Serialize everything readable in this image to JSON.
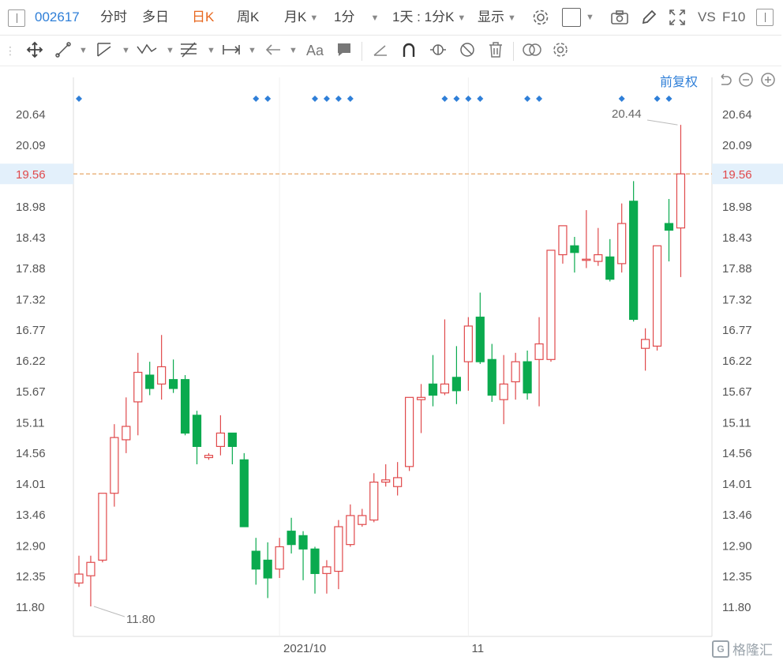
{
  "toolbar": {
    "code": "002617",
    "tabs": [
      "分时",
      "多日",
      "日K",
      "周K",
      "月K"
    ],
    "active_tab": "日K",
    "interval": "1分",
    "range": "1天 : 1分K",
    "display": "显示",
    "vs": "VS",
    "f10": "F10"
  },
  "price_mode": "前复权",
  "colors": {
    "up": "#e0494b",
    "down": "#0aaa4e",
    "accent": "#2f7fd8",
    "active_tab": "#e8681f",
    "price_line": "#e8a867"
  },
  "watermark": "格隆汇",
  "chart_data": {
    "type": "candlestick",
    "y_ticks": [
      "20.64",
      "20.09",
      "19.56",
      "18.98",
      "18.43",
      "17.88",
      "17.32",
      "16.77",
      "16.22",
      "15.67",
      "15.11",
      "14.56",
      "14.01",
      "13.46",
      "12.90",
      "12.35",
      "11.80"
    ],
    "ylim": [
      11.8,
      20.64
    ],
    "x_tick_labels": [
      {
        "label": "2021/10",
        "index": 17
      },
      {
        "label": "11",
        "index": 33
      }
    ],
    "current_price": "19.56",
    "max_label": "20.44",
    "min_label": "11.80",
    "max_index": 51,
    "min_index": 1,
    "event_marker_indices": [
      0,
      15,
      16,
      20,
      21,
      22,
      23,
      31,
      32,
      33,
      34,
      38,
      39,
      46,
      49,
      50
    ],
    "candles": [
      {
        "o": 12.22,
        "c": 12.38,
        "h": 12.71,
        "l": 12.15
      },
      {
        "o": 12.35,
        "c": 12.59,
        "h": 12.71,
        "l": 11.8
      },
      {
        "o": 12.63,
        "c": 13.83,
        "h": 13.83,
        "l": 12.59
      },
      {
        "o": 13.83,
        "c": 14.83,
        "h": 15.07,
        "l": 13.59
      },
      {
        "o": 14.79,
        "c": 15.03,
        "h": 15.55,
        "l": 14.55
      },
      {
        "o": 15.47,
        "c": 16.0,
        "h": 16.35,
        "l": 14.87
      },
      {
        "o": 15.95,
        "c": 15.71,
        "h": 16.19,
        "l": 15.59
      },
      {
        "o": 15.79,
        "c": 16.1,
        "h": 16.67,
        "l": 15.51
      },
      {
        "o": 15.87,
        "c": 15.71,
        "h": 16.23,
        "l": 15.63
      },
      {
        "o": 15.87,
        "c": 14.91,
        "h": 15.95,
        "l": 14.87
      },
      {
        "o": 15.23,
        "c": 14.67,
        "h": 15.31,
        "l": 14.35
      },
      {
        "o": 14.47,
        "c": 14.51,
        "h": 14.55,
        "l": 14.43
      },
      {
        "o": 14.67,
        "c": 14.91,
        "h": 15.23,
        "l": 14.51
      },
      {
        "o": 14.91,
        "c": 14.67,
        "h": 14.91,
        "l": 14.35
      },
      {
        "o": 14.43,
        "c": 13.23,
        "h": 14.55,
        "l": 13.23
      },
      {
        "o": 12.79,
        "c": 12.47,
        "h": 13.03,
        "l": 12.19
      },
      {
        "o": 12.63,
        "c": 12.31,
        "h": 12.95,
        "l": 11.95
      },
      {
        "o": 12.47,
        "c": 12.87,
        "h": 13.03,
        "l": 12.31
      },
      {
        "o": 13.15,
        "c": 12.91,
        "h": 13.39,
        "l": 12.75
      },
      {
        "o": 13.07,
        "c": 12.83,
        "h": 13.15,
        "l": 12.27
      },
      {
        "o": 12.83,
        "c": 12.39,
        "h": 12.87,
        "l": 12.03
      },
      {
        "o": 12.39,
        "c": 12.51,
        "h": 12.63,
        "l": 12.03
      },
      {
        "o": 12.43,
        "c": 13.23,
        "h": 13.35,
        "l": 12.11
      },
      {
        "o": 12.91,
        "c": 13.43,
        "h": 13.63,
        "l": 12.87
      },
      {
        "o": 13.27,
        "c": 13.43,
        "h": 13.55,
        "l": 13.23
      },
      {
        "o": 13.35,
        "c": 14.03,
        "h": 14.19,
        "l": 13.31
      },
      {
        "o": 14.03,
        "c": 14.07,
        "h": 14.35,
        "l": 13.95
      },
      {
        "o": 13.95,
        "c": 14.11,
        "h": 14.39,
        "l": 13.79
      },
      {
        "o": 14.31,
        "c": 15.55,
        "h": 15.55,
        "l": 14.23
      },
      {
        "o": 15.51,
        "c": 15.55,
        "h": 15.79,
        "l": 14.91
      },
      {
        "o": 15.79,
        "c": 15.59,
        "h": 16.31,
        "l": 15.39
      },
      {
        "o": 15.63,
        "c": 15.79,
        "h": 16.95,
        "l": 15.59
      },
      {
        "o": 15.91,
        "c": 15.67,
        "h": 16.47,
        "l": 15.43
      },
      {
        "o": 16.19,
        "c": 16.83,
        "h": 16.99,
        "l": 15.67
      },
      {
        "o": 16.99,
        "c": 16.19,
        "h": 17.43,
        "l": 16.15
      },
      {
        "o": 16.23,
        "c": 15.59,
        "h": 16.51,
        "l": 15.47
      },
      {
        "o": 15.51,
        "c": 15.79,
        "h": 16.31,
        "l": 15.07
      },
      {
        "o": 15.83,
        "c": 16.19,
        "h": 16.35,
        "l": 15.51
      },
      {
        "o": 16.19,
        "c": 15.63,
        "h": 16.39,
        "l": 15.51
      },
      {
        "o": 16.23,
        "c": 16.51,
        "h": 16.99,
        "l": 15.39
      },
      {
        "o": 16.23,
        "c": 18.19,
        "h": 18.19,
        "l": 16.19
      },
      {
        "o": 18.11,
        "c": 18.63,
        "h": 18.63,
        "l": 17.95
      },
      {
        "o": 18.27,
        "c": 18.15,
        "h": 18.43,
        "l": 17.79
      },
      {
        "o": 18.03,
        "c": 18.03,
        "h": 18.91,
        "l": 17.87
      },
      {
        "o": 17.99,
        "c": 18.11,
        "h": 18.59,
        "l": 17.91
      },
      {
        "o": 18.07,
        "c": 17.67,
        "h": 18.39,
        "l": 17.63
      },
      {
        "o": 17.95,
        "c": 18.67,
        "h": 19.03,
        "l": 17.79
      },
      {
        "o": 19.07,
        "c": 16.95,
        "h": 19.43,
        "l": 16.91
      },
      {
        "o": 16.43,
        "c": 16.59,
        "h": 16.79,
        "l": 16.03
      },
      {
        "o": 16.47,
        "c": 18.27,
        "h": 18.27,
        "l": 16.39
      },
      {
        "o": 18.67,
        "c": 18.55,
        "h": 19.11,
        "l": 17.99
      },
      {
        "o": 18.59,
        "c": 19.56,
        "h": 20.44,
        "l": 17.71
      }
    ]
  }
}
